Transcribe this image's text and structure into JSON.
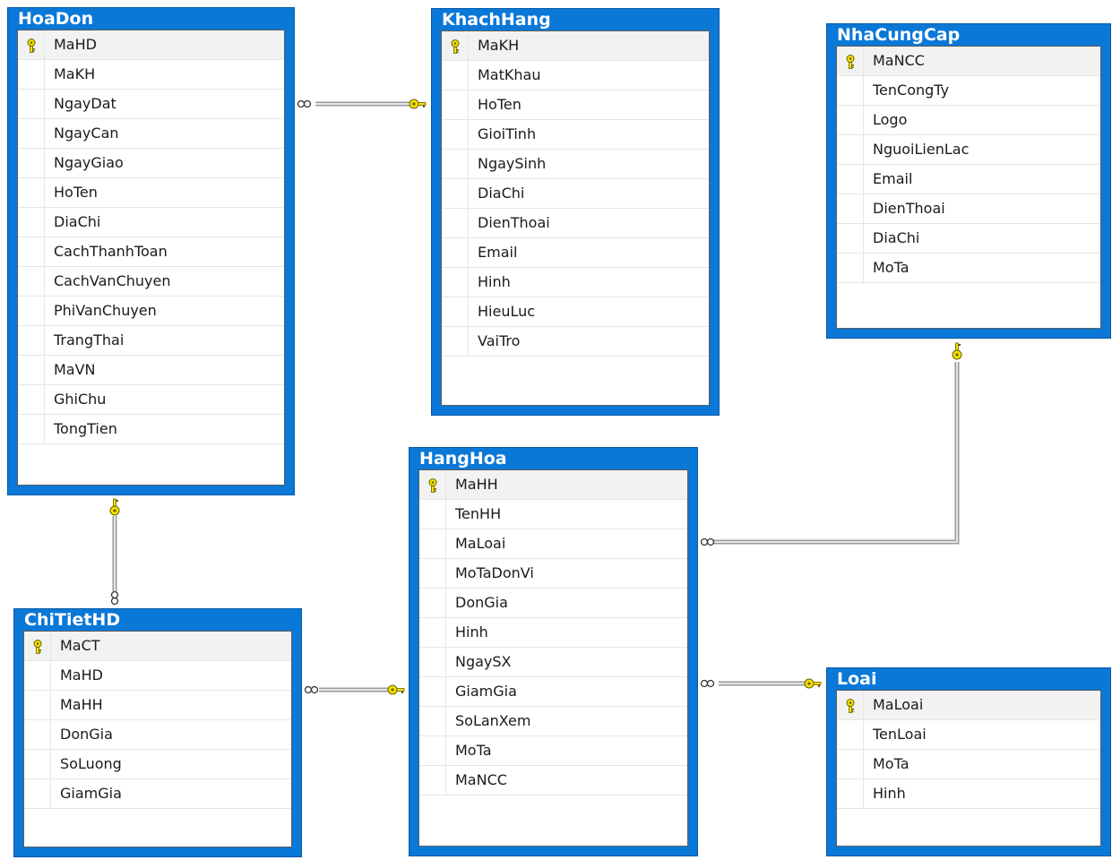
{
  "colors": {
    "table_header": "#0a78d7",
    "key_icon": "#f4e000",
    "connector": "#9a9a9a"
  },
  "tables": {
    "HoaDon": {
      "title": "HoaDon",
      "columns": [
        "MaHD",
        "MaKH",
        "NgayDat",
        "NgayCan",
        "NgayGiao",
        "HoTen",
        "DiaChi",
        "CachThanhToan",
        "CachVanChuyen",
        "PhiVanChuyen",
        "TrangThai",
        "MaVN",
        "GhiChu",
        "TongTien"
      ],
      "primary_key": "MaHD"
    },
    "KhachHang": {
      "title": "KhachHang",
      "columns": [
        "MaKH",
        "MatKhau",
        "HoTen",
        "GioiTinh",
        "NgaySinh",
        "DiaChi",
        "DienThoai",
        "Email",
        "Hinh",
        "HieuLuc",
        "VaiTro"
      ],
      "primary_key": "MaKH"
    },
    "NhaCungCap": {
      "title": "NhaCungCap",
      "columns": [
        "MaNCC",
        "TenCongTy",
        "Logo",
        "NguoiLienLac",
        "Email",
        "DienThoai",
        "DiaChi",
        "MoTa"
      ],
      "primary_key": "MaNCC"
    },
    "HangHoa": {
      "title": "HangHoa",
      "columns": [
        "MaHH",
        "TenHH",
        "MaLoai",
        "MoTaDonVi",
        "DonGia",
        "Hinh",
        "NgaySX",
        "GiamGia",
        "SoLanXem",
        "MoTa",
        "MaNCC"
      ],
      "primary_key": "MaHH"
    },
    "ChiTietHD": {
      "title": "ChiTietHD",
      "columns": [
        "MaCT",
        "MaHD",
        "MaHH",
        "DonGia",
        "SoLuong",
        "GiamGia"
      ],
      "primary_key": "MaCT"
    },
    "Loai": {
      "title": "Loai",
      "columns": [
        "MaLoai",
        "TenLoai",
        "MoTa",
        "Hinh"
      ],
      "primary_key": "MaLoai"
    }
  },
  "relationships": [
    {
      "from": "HoaDon",
      "to": "KhachHang",
      "many_end": "HoaDon",
      "one_end": "KhachHang"
    },
    {
      "from": "ChiTietHD",
      "to": "HoaDon",
      "many_end": "ChiTietHD",
      "one_end": "HoaDon"
    },
    {
      "from": "ChiTietHD",
      "to": "HangHoa",
      "many_end": "ChiTietHD",
      "one_end": "HangHoa"
    },
    {
      "from": "HangHoa",
      "to": "NhaCungCap",
      "many_end": "HangHoa",
      "one_end": "NhaCungCap"
    },
    {
      "from": "HangHoa",
      "to": "Loai",
      "many_end": "HangHoa",
      "one_end": "Loai"
    }
  ]
}
